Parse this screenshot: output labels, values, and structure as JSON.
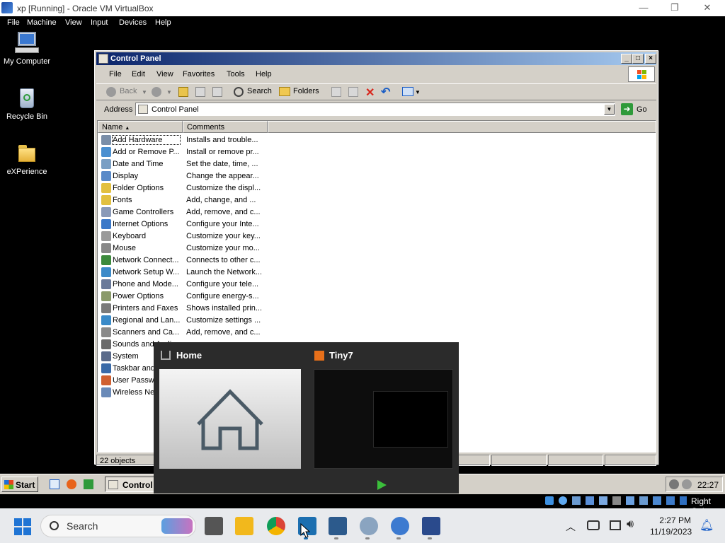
{
  "host": {
    "title": "xp [Running] - Oracle VM VirtualBox",
    "window_controls": {
      "minimize": "—",
      "restore": "❐",
      "close": "✕"
    },
    "menu": [
      "File",
      "Machine",
      "View",
      "Input",
      "Devices",
      "Help"
    ],
    "status_right": "Right Ctrl"
  },
  "desktop_icons": [
    "My Computer",
    "Recycle Bin",
    "eXPerience"
  ],
  "control_panel": {
    "title": "Control Panel",
    "menu": [
      "File",
      "Edit",
      "View",
      "Favorites",
      "Tools",
      "Help"
    ],
    "toolbar": {
      "back": "Back",
      "search": "Search",
      "folders": "Folders"
    },
    "address_label": "Address",
    "address_value": "Control Panel",
    "go_label": "Go",
    "columns": [
      "Name",
      "Comments"
    ],
    "items": [
      {
        "name": "Add Hardware",
        "comment": "Installs and trouble..."
      },
      {
        "name": "Add or Remove P...",
        "comment": "Install or remove pr..."
      },
      {
        "name": "Date and Time",
        "comment": "Set the date, time, ..."
      },
      {
        "name": "Display",
        "comment": "Change the appear..."
      },
      {
        "name": "Folder Options",
        "comment": "Customize the displ..."
      },
      {
        "name": "Fonts",
        "comment": "Add, change, and ..."
      },
      {
        "name": "Game Controllers",
        "comment": "Add, remove, and c..."
      },
      {
        "name": "Internet Options",
        "comment": "Configure your Inte..."
      },
      {
        "name": "Keyboard",
        "comment": "Customize your key..."
      },
      {
        "name": "Mouse",
        "comment": "Customize your mo..."
      },
      {
        "name": "Network Connect...",
        "comment": "Connects to other c..."
      },
      {
        "name": "Network Setup W...",
        "comment": "Launch the Network..."
      },
      {
        "name": "Phone and Mode...",
        "comment": "Configure your tele..."
      },
      {
        "name": "Power Options",
        "comment": "Configure energy-s..."
      },
      {
        "name": "Printers and Faxes",
        "comment": "Shows installed prin..."
      },
      {
        "name": "Regional and Lan...",
        "comment": "Customize settings ..."
      },
      {
        "name": "Scanners and Ca...",
        "comment": "Add, remove, and c..."
      },
      {
        "name": "Sounds and Audio...",
        "comment": ""
      },
      {
        "name": "System",
        "comment": ""
      },
      {
        "name": "Taskbar and...",
        "comment": ""
      },
      {
        "name": "User Passwo...",
        "comment": ""
      },
      {
        "name": "Wireless Net...",
        "comment": ""
      }
    ],
    "status": "22 objects"
  },
  "xp_taskbar": {
    "start": "Start",
    "task": "Control",
    "clock": "22:27"
  },
  "preview": {
    "home_title": "Home",
    "tiny_title": "Tiny7"
  },
  "win11": {
    "search": "Search",
    "time": "2:27 PM",
    "date": "11/19/2023"
  }
}
